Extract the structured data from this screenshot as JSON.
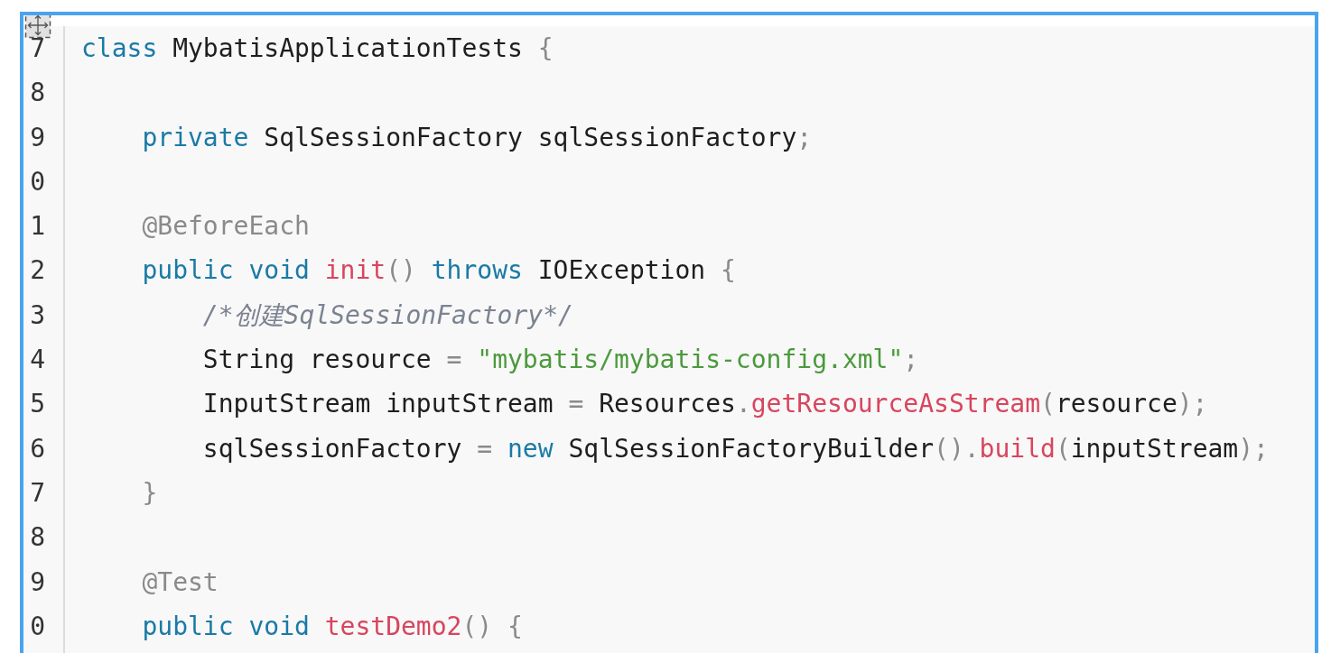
{
  "editor": {
    "lines": [
      {
        "number": "7",
        "tokens": [
          {
            "kind": "keyword",
            "text": "class"
          },
          {
            "kind": "plain",
            "text": " MybatisApplicationTests "
          },
          {
            "kind": "punct",
            "text": "{"
          }
        ],
        "children": [
          {
            "number": "8"
          },
          {
            "number": "9",
            "tokens": [
              {
                "kind": "keyword",
                "text": "private"
              },
              {
                "kind": "plain",
                "text": " SqlSessionFactory sqlSessionFactory"
              },
              {
                "kind": "punct",
                "text": ";"
              }
            ]
          },
          {
            "number": "0"
          },
          {
            "number": "1",
            "tokens": [
              {
                "kind": "annotation",
                "text": "@BeforeEach"
              }
            ]
          },
          {
            "number": "2",
            "tokens": [
              {
                "kind": "keyword",
                "text": "public void "
              },
              {
                "kind": "function",
                "text": "init"
              },
              {
                "kind": "punct",
                "text": "() "
              },
              {
                "kind": "keyword",
                "text": "throws"
              },
              {
                "kind": "plain",
                "text": " IOException "
              },
              {
                "kind": "punct",
                "text": "{"
              }
            ],
            "children": [
              {
                "number": "3",
                "tokens": [
                  {
                    "kind": "comment",
                    "text": "/*创建SqlSessionFactory*/"
                  }
                ]
              },
              {
                "number": "4",
                "tokens": [
                  {
                    "kind": "plain",
                    "text": "String resource "
                  },
                  {
                    "kind": "punct",
                    "text": "= "
                  },
                  {
                    "kind": "string",
                    "text": "\"mybatis/mybatis-config.xml\""
                  },
                  {
                    "kind": "punct",
                    "text": ";"
                  }
                ]
              },
              {
                "number": "5",
                "tokens": [
                  {
                    "kind": "plain",
                    "text": "InputStream inputStream "
                  },
                  {
                    "kind": "punct",
                    "text": "= "
                  },
                  {
                    "kind": "plain",
                    "text": "Resources"
                  },
                  {
                    "kind": "punct",
                    "text": "."
                  },
                  {
                    "kind": "function",
                    "text": "getResourceAsStream"
                  },
                  {
                    "kind": "punct",
                    "text": "("
                  },
                  {
                    "kind": "plain",
                    "text": "resource"
                  },
                  {
                    "kind": "punct",
                    "text": ");"
                  }
                ]
              },
              {
                "number": "6",
                "tokens": [
                  {
                    "kind": "plain",
                    "text": "sqlSessionFactory "
                  },
                  {
                    "kind": "punct",
                    "text": "= "
                  },
                  {
                    "kind": "keyword",
                    "text": "new"
                  },
                  {
                    "kind": "plain",
                    "text": " SqlSessionFactoryBuilder"
                  },
                  {
                    "kind": "punct",
                    "text": "()."
                  },
                  {
                    "kind": "function",
                    "text": "build"
                  },
                  {
                    "kind": "punct",
                    "text": "("
                  },
                  {
                    "kind": "plain",
                    "text": "inputStream"
                  },
                  {
                    "kind": "punct",
                    "text": ");"
                  }
                ]
              }
            ]
          },
          {
            "number": "7",
            "tokens": [
              {
                "kind": "punct",
                "text": "}"
              }
            ]
          },
          {
            "number": "8"
          },
          {
            "number": "9",
            "tokens": [
              {
                "kind": "annotation",
                "text": "@Test"
              }
            ]
          },
          {
            "number": "0",
            "tokens": [
              {
                "kind": "keyword",
                "text": "public void "
              },
              {
                "kind": "function",
                "text": "testDemo2"
              },
              {
                "kind": "punct",
                "text": "() {"
              }
            ]
          }
        ]
      }
    ]
  }
}
